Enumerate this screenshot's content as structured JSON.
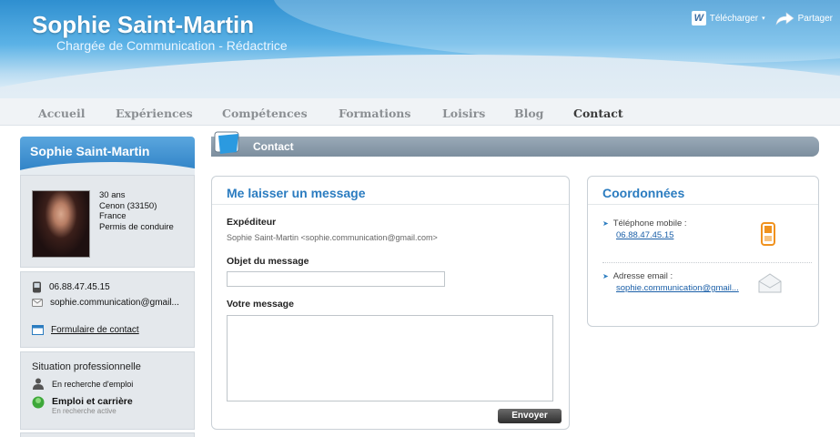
{
  "header": {
    "name": "Sophie Saint-Martin",
    "subtitle": "Chargée de Communication - Rédactrice",
    "download_label": "Télécharger",
    "share_label": "Partager"
  },
  "nav": {
    "items": [
      "Accueil",
      "Expériences",
      "Compétences",
      "Formations",
      "Loisirs",
      "Blog",
      "Contact"
    ],
    "active": "Contact"
  },
  "sidebar": {
    "title": "Sophie Saint-Martin",
    "profile": {
      "age": "30 ans",
      "city": "Cenon (33150)",
      "country": "France",
      "license": "Permis de conduire"
    },
    "contact": {
      "phone": "06.88.47.45.15",
      "email": "sophie.communication@gmail...",
      "form_link": "Formulaire de contact"
    },
    "situation": {
      "title": "Situation professionnelle",
      "status": "En recherche d'emploi",
      "job_title": "Emploi et carrière",
      "job_sub": "En recherche active"
    }
  },
  "main": {
    "section_title": "Contact",
    "message_form": {
      "title": "Me laisser un message",
      "sender_label": "Expéditeur",
      "sender_value": "Sophie Saint-Martin <sophie.communication@gmail.com>",
      "subject_label": "Objet du message",
      "subject_value": "",
      "message_label": "Votre message",
      "message_value": "",
      "send_label": "Envoyer"
    },
    "coordinates": {
      "title": "Coordonnées",
      "phone_label": "Téléphone mobile :",
      "phone_value": "06.88.47.45.15",
      "email_label": "Adresse email :",
      "email_value": "sophie.communication@gmail..."
    }
  },
  "colors": {
    "accent_blue": "#2b7cc0",
    "header_blue": "#2f8fd0",
    "phone_icon": "#f0921e"
  }
}
